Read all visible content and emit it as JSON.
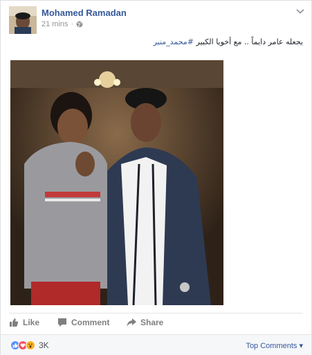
{
  "post": {
    "author": "Mohamed Ramadan",
    "time": "21 mins",
    "separator": "·",
    "text_main": "يجعله عامر دايماً .. مع أخويا الكبير ",
    "text_hashtag": "#محمد_منير"
  },
  "actions": {
    "like": "Like",
    "comment": "Comment",
    "share": "Share"
  },
  "reactions": {
    "count": "3K",
    "icons": [
      "like-icon",
      "love-icon",
      "wow-icon"
    ]
  },
  "top_comments": "Top Comments ▾",
  "colors": {
    "link": "#365899",
    "muted": "#90949c",
    "action": "#7f7f7f",
    "like_blue": "#5890ff",
    "love_red": "#f25268",
    "wow_yellow": "#f7b125"
  }
}
